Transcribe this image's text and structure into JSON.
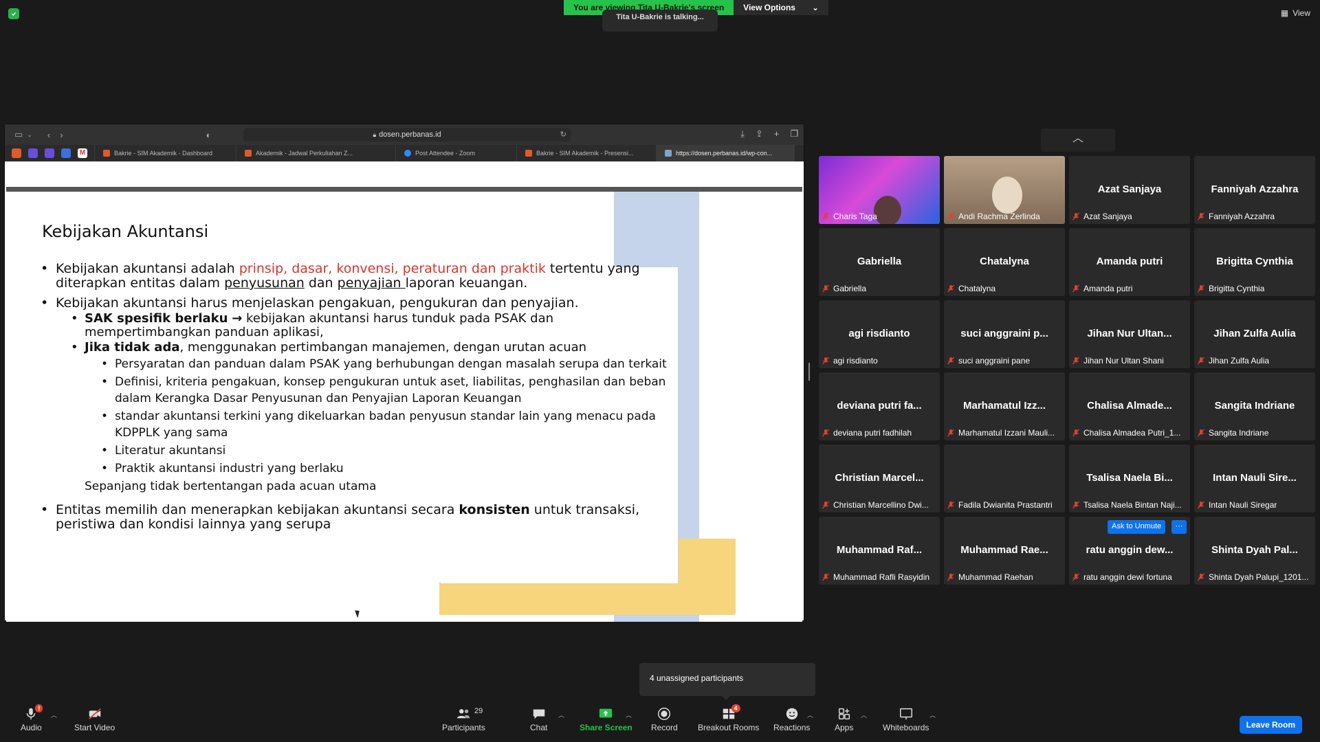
{
  "banner": {
    "viewing": "You are viewing Tita U-Bakrie's screen",
    "view_options": "View Options",
    "talking": "Tita U-Bakrie is talking...",
    "view_button": "View"
  },
  "browser": {
    "url": "dosen.perbanas.id",
    "tabs": [
      {
        "label": "Bakrie - SIM Akademik - Dashboard"
      },
      {
        "label": "Akademik - Jadwal Perkuliahan Z..."
      },
      {
        "label": "Post Attendee - Zoom"
      },
      {
        "label": "Bakrie - SIM Akademik - Presensi..."
      },
      {
        "label": "https://dosen.perbanas.id/wp-con..."
      }
    ]
  },
  "slide": {
    "title": "Kebijakan Akuntansi",
    "p1": {
      "a": "Kebijakan akuntansi adalah ",
      "red": "prinsip, dasar, konvensi, peraturan dan praktik",
      "b": " tertentu yang diterapkan entitas dalam ",
      "u1": "penyusunan",
      "c": " dan ",
      "u2": "penyajian ",
      "d": "laporan keuangan."
    },
    "p2": "Kebijakan akuntansi harus menjelaskan pengakuan, pengukuran dan penyajian.",
    "p2_sub1_bold": "SAK spesifik berlaku",
    "p2_sub1_arrow": "→",
    "p2_sub1_rest": " kebijakan akuntansi harus tunduk pada PSAK dan mempertimbangkan panduan aplikasi,",
    "p2_sub2_bold": "Jika tidak ada",
    "p2_sub2_rest": ", menggunakan pertimbangan manajemen, dengan urutan acuan",
    "p2_sub2_items": [
      "Persyaratan dan panduan dalam PSAK yang berhubungan dengan masalah serupa dan terkait",
      "Definisi, kriteria pengakuan, konsep pengukuran untuk aset, liabilitas, penghasilan dan beban dalam Kerangka Dasar Penyusunan dan Penyajian Laporan Keuangan",
      "standar akuntansi terkini yang dikeluarkan badan penyusun standar lain yang menacu pada KDPPLK yang sama",
      "Literatur akuntansi",
      "Praktik akuntansi industri yang berlaku"
    ],
    "p2_plain": "Sepanjang tidak bertentangan pada acuan utama",
    "p3_a": "Entitas memilih dan menerapkan kebijakan akuntansi secara ",
    "p3_bold": "konsisten",
    "p3_b": " untuk transaksi, peristiwa dan kondisi lainnya yang serupa"
  },
  "gallery": {
    "tiles": [
      {
        "big": "",
        "label": "Charis Taga",
        "video": "v1"
      },
      {
        "big": "",
        "label": "Andi Rachma Zerlinda",
        "video": "v2"
      },
      {
        "big": "Azat Sanjaya",
        "label": "Azat Sanjaya",
        "video": ""
      },
      {
        "big": "Fanniyah Azzahra",
        "label": "Fanniyah Azzahra",
        "video": ""
      },
      {
        "big": "Gabriella",
        "label": "Gabriella",
        "video": ""
      },
      {
        "big": "Chatalyna",
        "label": "Chatalyna",
        "video": ""
      },
      {
        "big": "Amanda putri",
        "label": "Amanda putri",
        "video": ""
      },
      {
        "big": "Brigitta Cynthia",
        "label": "Brigitta Cynthia",
        "video": ""
      },
      {
        "big": "agi risdianto",
        "label": "agi risdianto",
        "video": ""
      },
      {
        "big": "suci anggraini p...",
        "label": "suci anggraini pane",
        "video": ""
      },
      {
        "big": "Jihan Nur Ultan...",
        "label": "Jihan Nur Ultan Shani",
        "video": ""
      },
      {
        "big": "Jihan Zulfa Aulia",
        "label": "Jihan Zulfa Aulia",
        "video": ""
      },
      {
        "big": "deviana putri fa...",
        "label": "deviana putri fadhilah",
        "video": ""
      },
      {
        "big": "Marhamatul Izz...",
        "label": "Marhamatul Izzani Mauli...",
        "video": ""
      },
      {
        "big": "Chalisa Almade...",
        "label": "Chalisa Almadea Putri_1...",
        "video": ""
      },
      {
        "big": "Sangita Indriane",
        "label": "Sangita Indriane",
        "video": ""
      },
      {
        "big": "Christian Marcel...",
        "label": "Christian Marcellino Dwi...",
        "video": ""
      },
      {
        "big": "",
        "label": "Fadila Dwianita Prastantri",
        "video": ""
      },
      {
        "big": "Tsalisa Naela Bi...",
        "label": "Tsalisa Naela Bintan Naji...",
        "video": ""
      },
      {
        "big": "Intan Nauli Sire...",
        "label": "Intan Nauli Siregar",
        "video": ""
      },
      {
        "big": "Muhammad Raf...",
        "label": "Muhammad Rafli Rasyidin",
        "video": ""
      },
      {
        "big": "Muhammad Rae...",
        "label": "Muhammad Raehan",
        "video": ""
      },
      {
        "big": "ratu anggin dew...",
        "label": "ratu anggin dewi fortuna",
        "video": ""
      },
      {
        "big": "Shinta Dyah Pal...",
        "label": "Shinta Dyah Palupi_1201...",
        "video": ""
      }
    ],
    "ask_to_unmute": "Ask to Unmute",
    "more": "···"
  },
  "tooltip": "4 unassigned participants",
  "toolbar": {
    "audio": "Audio",
    "audio_badge": "!",
    "start_video": "Start Video",
    "participants": "Participants",
    "participants_count": "29",
    "chat": "Chat",
    "share_screen": "Share Screen",
    "record": "Record",
    "breakout_rooms": "Breakout Rooms",
    "breakout_badge": "4",
    "reactions": "Reactions",
    "apps": "Apps",
    "whiteboards": "Whiteboards",
    "leave": "Leave Room"
  },
  "colors": {
    "green": "#27c24c",
    "blue": "#0e72ed",
    "red": "#e0422f",
    "slide_red": "#d9342b"
  }
}
